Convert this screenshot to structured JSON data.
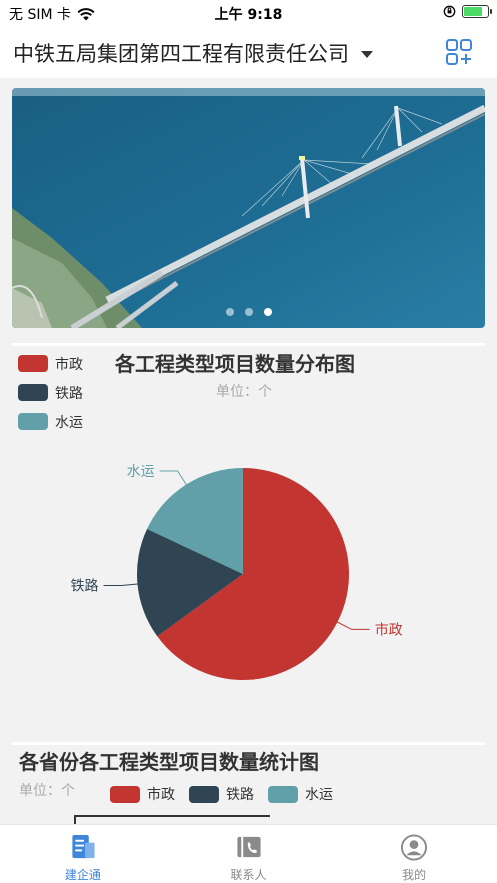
{
  "status_bar": {
    "carrier": "无 SIM 卡",
    "time": "上午 9:18"
  },
  "header": {
    "company": "中铁五局集团第四工程有限责任公司"
  },
  "banner": {
    "dots": 3,
    "active_dot": 2
  },
  "chart1": {
    "title": "各工程类型项目数量分布图",
    "subtitle": "单位：个",
    "legend": [
      {
        "label": "市政",
        "color": "#c23531"
      },
      {
        "label": "铁路",
        "color": "#2f4554"
      },
      {
        "label": "水运",
        "color": "#61a0a8"
      }
    ]
  },
  "chart2": {
    "title": "各省份各工程类型项目数量统计图",
    "subtitle": "单位：个",
    "legend": [
      {
        "label": "市政",
        "color": "#c23531"
      },
      {
        "label": "铁路",
        "color": "#2f4554"
      },
      {
        "label": "水运",
        "color": "#61a0a8"
      }
    ]
  },
  "chart_data": {
    "type": "pie",
    "title": "各工程类型项目数量分布图",
    "subtitle": "单位：个",
    "legend_position": "top-left",
    "slices": [
      {
        "name": "市政",
        "value": 65,
        "color": "#c23531"
      },
      {
        "name": "铁路",
        "value": 17,
        "color": "#2f4554"
      },
      {
        "name": "水运",
        "value": 18,
        "color": "#61a0a8"
      }
    ]
  },
  "tabs": [
    {
      "label": "建企通",
      "icon": "doc-icon",
      "active": true
    },
    {
      "label": "联系人",
      "icon": "contact-icon",
      "active": false
    },
    {
      "label": "我的",
      "icon": "profile-icon",
      "active": false
    }
  ]
}
